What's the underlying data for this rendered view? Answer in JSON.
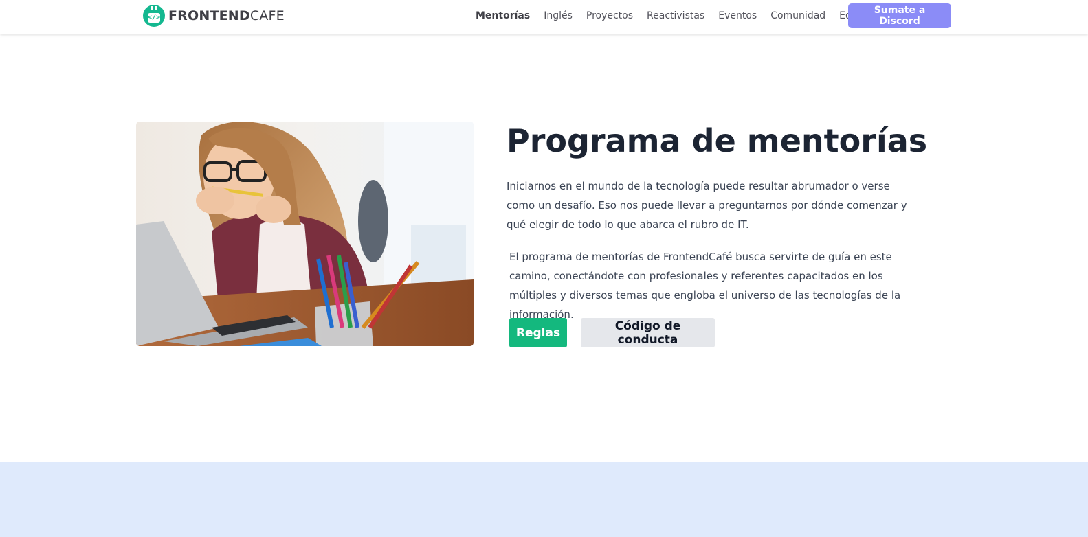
{
  "brand": {
    "name_bold": "FRONTEND",
    "name_light": "CAFE",
    "logo_glyph": "</>",
    "color": "#14b890"
  },
  "nav": {
    "items": [
      {
        "label": "Mentorías",
        "active": true
      },
      {
        "label": "Inglés",
        "active": false
      },
      {
        "label": "Proyectos",
        "active": false
      },
      {
        "label": "Reactivistas",
        "active": false
      },
      {
        "label": "Eventos",
        "active": false
      },
      {
        "label": "Comunidad",
        "active": false
      },
      {
        "label": "Equipo",
        "active": false
      }
    ],
    "cta_label": "Sumate a Discord",
    "cta_color": "#8b8cf7"
  },
  "hero": {
    "title": "Programa de mentorías",
    "paragraph_1": "Iniciarnos en el mundo de la tecnología puede resultar abrumador o verse como un desafío. Eso nos puede llevar a preguntarnos por dónde comenzar y qué elegir de todo lo que abarca el rubro de IT.",
    "paragraph_2": "El programa de mentorías de FrontendCafé busca servirte de guía en este camino, conectándote con profesionales y referentes capacitados en los múltiples y diversos temas que engloba el universo de las tecnologías de la información.",
    "image_icon": "woman-at-laptop-photo",
    "buttons": {
      "rules_label": "Reglas",
      "conduct_label": "Código de conducta"
    },
    "colors": {
      "primary_button": "#14b87e",
      "secondary_button": "#e5e7eb",
      "title": "#1c2433"
    }
  },
  "footer_band": {
    "color": "#dfeafc"
  }
}
